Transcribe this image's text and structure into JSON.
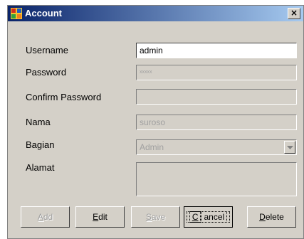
{
  "window": {
    "title": "Account",
    "close_symbol": "×"
  },
  "form": {
    "username": {
      "label": "Username",
      "value": "admin"
    },
    "password": {
      "label": "Password",
      "value": "xxxxx"
    },
    "confirm_password": {
      "label": "Confirm Password",
      "value": ""
    },
    "nama": {
      "label": "Nama",
      "value": "suroso"
    },
    "bagian": {
      "label": "Bagian",
      "value": "Admin"
    },
    "alamat": {
      "label": "Alamat",
      "value": ""
    }
  },
  "buttons": {
    "add": {
      "accel": "A",
      "rest": "dd"
    },
    "edit": {
      "accel": "E",
      "rest": "dit"
    },
    "save": {
      "accel": "S",
      "rest": "ave"
    },
    "cancel": {
      "accel": "C",
      "rest": "ancel"
    },
    "delete": {
      "accel": "D",
      "rest": "elete"
    }
  }
}
